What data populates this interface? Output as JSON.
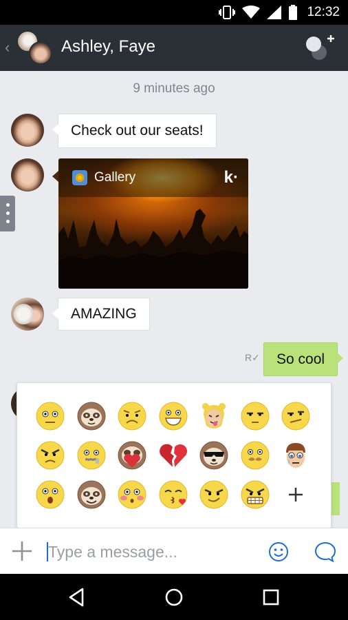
{
  "status_bar": {
    "time": "12:32"
  },
  "header": {
    "title": "Ashley, Faye"
  },
  "chat": {
    "timestamp": "9 minutes ago",
    "messages": [
      {
        "sender": "Faye",
        "text": "Check out our seats!"
      },
      {
        "sender": "Faye",
        "attachment": {
          "app": "Gallery",
          "logo": "k·"
        }
      },
      {
        "sender": "Ashley",
        "text": "AMAZING"
      },
      {
        "sender": "me",
        "text": "So cool",
        "receipt": "R"
      }
    ]
  },
  "emoji_panel": {
    "rows": [
      [
        "smiley-neutral",
        "sloth-neutral",
        "worried-face",
        "grinning-face",
        "blonde-girl-tongue",
        "unamused-face",
        "confused-face"
      ],
      [
        "angry-face",
        "zipper-mouth",
        "sloth-heart",
        "broken-heart",
        "sloth-sunglasses",
        "mustache-face",
        "crying-boy"
      ],
      [
        "surprised-face",
        "sloth-happy",
        "blushing-face",
        "kissing-face",
        "smug-face",
        "grimace-face",
        "add-emoji"
      ]
    ]
  },
  "input": {
    "placeholder": "Type a message..."
  },
  "colors": {
    "header_bg": "#2b2f36",
    "my_bubble": "#b9e27a",
    "accent": "#1b6fd1"
  }
}
